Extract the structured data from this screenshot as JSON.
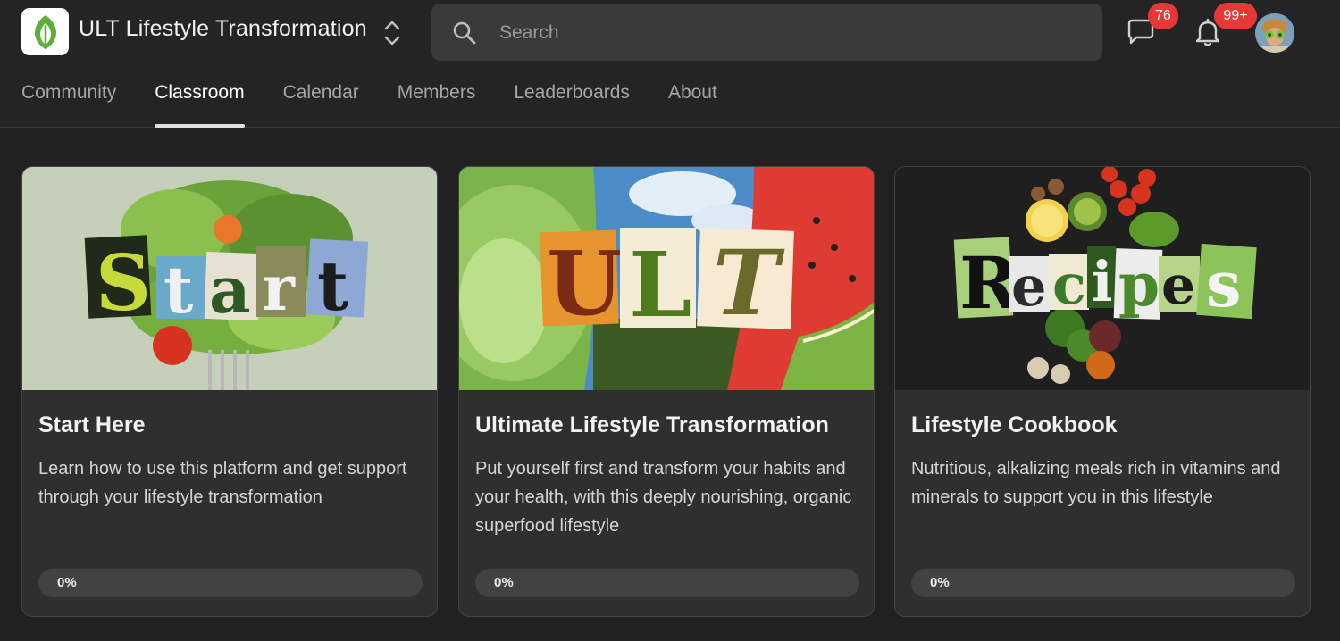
{
  "app": {
    "title": "ULT Lifestyle Transformation"
  },
  "search": {
    "placeholder": "Search"
  },
  "notifications": {
    "chat_count": "76",
    "bell_count": "99+"
  },
  "tabs": [
    {
      "label": "Community"
    },
    {
      "label": "Classroom"
    },
    {
      "label": "Calendar"
    },
    {
      "label": "Members"
    },
    {
      "label": "Leaderboards"
    },
    {
      "label": "About"
    }
  ],
  "active_tab": "Classroom",
  "courses": [
    {
      "title": "Start Here",
      "description": "Learn how to use this platform and get support through your lifestyle transformation",
      "progress": 0,
      "progress_label": "0%",
      "cover_text": [
        "S",
        "t",
        "a",
        "r",
        "t"
      ]
    },
    {
      "title": "Ultimate Lifestyle Transformation",
      "description": "Put yourself first and transform your habits and your health, with this deeply nourishing, organic superfood lifestyle",
      "progress": 0,
      "progress_label": "0%",
      "cover_text": [
        "U",
        "L",
        "T"
      ]
    },
    {
      "title": "Lifestyle Cookbook",
      "description": "Nutritious, alkalizing meals rich in vitamins and minerals to support you in this lifestyle",
      "progress": 0,
      "progress_label": "0%",
      "cover_text": [
        "R",
        "e",
        "c",
        "i",
        "p",
        "e",
        "s"
      ]
    }
  ],
  "colors": {
    "accent_badge": "#e53935",
    "brand_green": "#4caf50"
  },
  "icons": [
    "leaf-logo-icon",
    "chevron-updown-icon",
    "search-icon",
    "chat-bubble-icon",
    "bell-icon",
    "user-avatar"
  ]
}
